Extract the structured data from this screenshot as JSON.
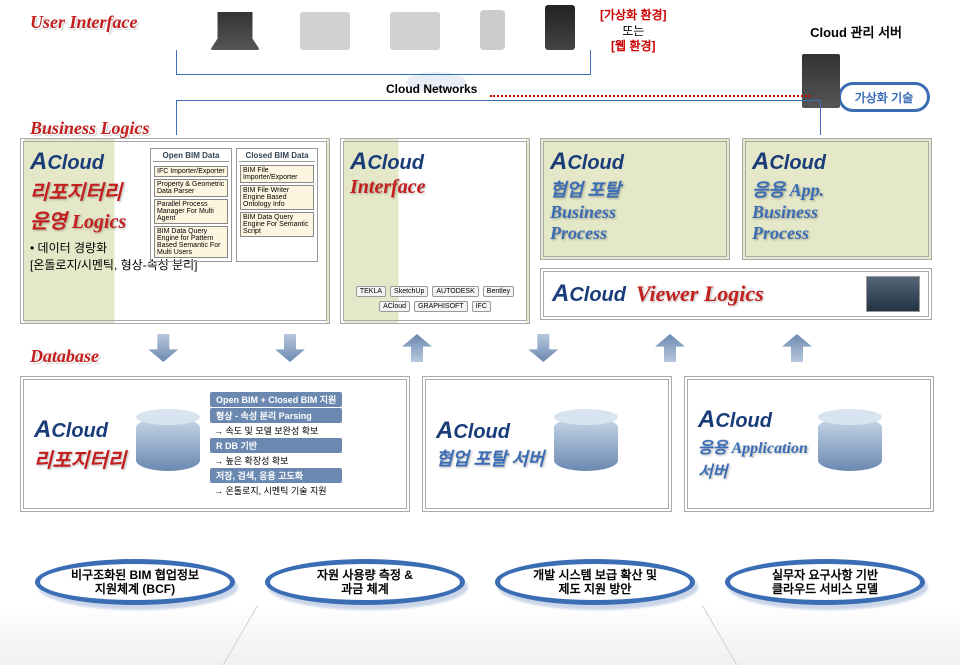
{
  "sections": {
    "ui": "User Interface",
    "biz": "Business Logics",
    "db": "Database"
  },
  "env": {
    "virtual": "[가상화 환경]",
    "or": "또는",
    "web": "[웹 환경]"
  },
  "cloud_mgmt": "Cloud 관리 서버",
  "virt_tech": "가상화 기술",
  "cloud_networks": "Cloud Networks",
  "logo": "Cloud",
  "cards": {
    "repo_logics": {
      "title_line1": "리포지터리",
      "title_line2": "운영 Logics",
      "sub": "• 데이터 경량화\n  [온돌로지/시멘틱, 형상-속성 분리]",
      "open_head": "Open BIM Data",
      "closed_head": "Closed BIM Data",
      "open_items": [
        "IFC Importer/Exporter",
        "Property & Geometric Data Parser",
        "Parallel Process Manager For Multi Agent",
        "BIM Data Query Engine for Pattern Based Semantic For Multi Users"
      ],
      "closed_items": [
        "BIM File Importer/Exporter",
        "BIM File Writer Engine Based Ontology Info",
        "BIM Data Query Engine For Semantic Script"
      ]
    },
    "interface": {
      "title": "Interface",
      "partners": [
        "TEKLA",
        "SketchUp",
        "AUTODESK",
        "Bentley",
        "ACloud",
        "GRAPHISOFT",
        "IFC"
      ]
    },
    "collab": {
      "title_line1": "협업 포탈",
      "title_line2": "Business",
      "title_line3": "Process"
    },
    "app": {
      "title_line1": "응용 App.",
      "title_line2": "Business",
      "title_line3": "Process"
    },
    "viewer": {
      "title": "Viewer Logics"
    }
  },
  "db_cards": {
    "repo": {
      "title": "리포지터리",
      "pills": [
        "Open BIM + Closed BIM 지원",
        "형상 - 속성 분리 Parsing",
        "R DB 기반"
      ],
      "arrows": [
        "→ 속도 및 모델 보완성 확보",
        "→ 높은 확장성 확보",
        "저장, 검색, 응용 고도화",
        "→ 온톨로지, 시멘틱 기술 지원"
      ]
    },
    "collab": {
      "title": "협업 포탈 서버"
    },
    "app": {
      "title_line1": "응용 Application",
      "title_line2": "서버"
    }
  },
  "ovals": [
    "비구조화된 BIM 협업정보\n지원체계 (BCF)",
    "자원 사용량 측정 &\n과금 체계",
    "개발 시스템 보급 확산 및\n제도 지원 방안",
    "실무자 요구사항 기반\n클라우드 서비스 모델"
  ]
}
